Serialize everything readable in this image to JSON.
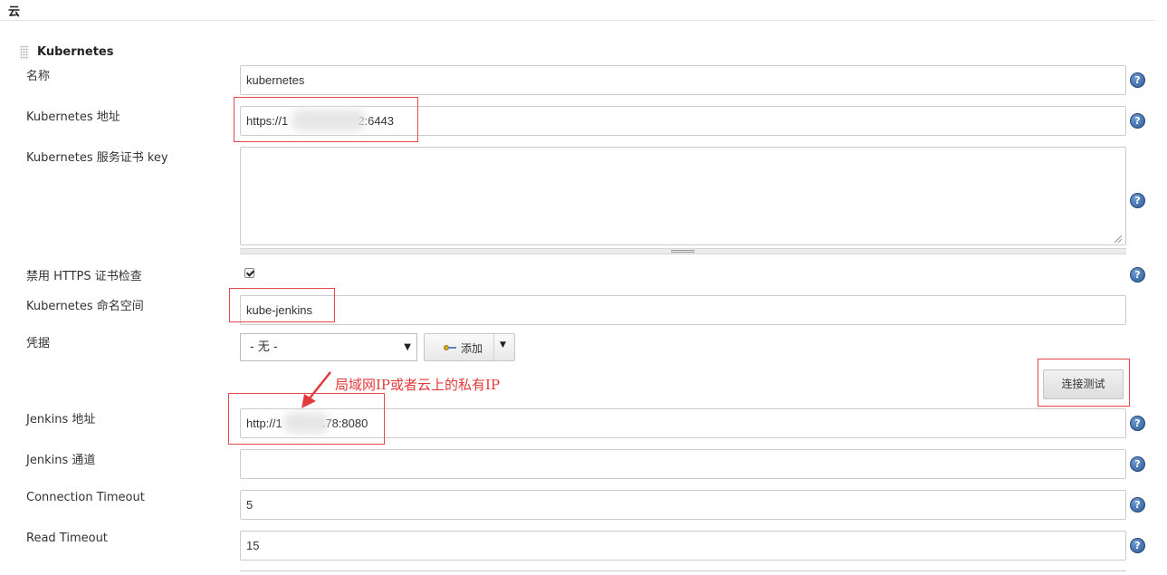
{
  "section": {
    "title": "云"
  },
  "cloud": {
    "name": "Kubernetes"
  },
  "fields": {
    "name": {
      "label": "名称",
      "value": "kubernetes"
    },
    "k8s_url": {
      "label": "Kubernetes 地址",
      "value_prefix": "https://1",
      "value_suffix": "2:6443"
    },
    "server_cert_key": {
      "label": "Kubernetes 服务证书 key",
      "value": ""
    },
    "disable_https_check": {
      "label": "禁用 HTTPS 证书检查",
      "checked": true
    },
    "namespace": {
      "label": "Kubernetes 命名空间",
      "value": "kube-jenkins"
    },
    "credentials": {
      "label": "凭据",
      "selected": "- 无 -",
      "add_label": "添加"
    },
    "jenkins_url": {
      "label": "Jenkins 地址",
      "value_prefix": "http://1",
      "value_suffix": ".78:8080"
    },
    "jenkins_tunnel": {
      "label": "Jenkins 通道",
      "value": ""
    },
    "connection_timeout": {
      "label": "Connection Timeout",
      "value": "5"
    },
    "read_timeout": {
      "label": "Read Timeout",
      "value": "15"
    }
  },
  "buttons": {
    "test_connection": "连接测试"
  },
  "annotation": {
    "text": "局域网IP或者云上的私有IP"
  },
  "help": {
    "glyph": "?"
  },
  "icons": {
    "help": "help-icon",
    "add_key": "key-icon",
    "select_caret": "caret-down-icon",
    "drag_handle": "drag-handle-icon"
  },
  "colors": {
    "annotation_red": "#e23a3a",
    "help_blue": "#2e5c99"
  }
}
